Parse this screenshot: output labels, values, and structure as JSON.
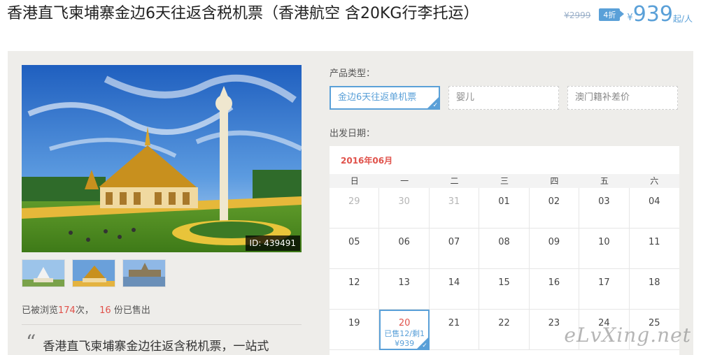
{
  "product": {
    "title": "香港直飞柬埔寨金边6天往返含税机票（香港航空 含20KG行李托运）"
  },
  "price": {
    "original": "¥2999",
    "discount": "4折",
    "currency": "¥",
    "amount": "939",
    "unit": "起/人"
  },
  "gallery": {
    "photo_id": "ID: 439491"
  },
  "stats": {
    "prefix": "已被浏览",
    "views": "174",
    "middle": "次，",
    "sold": "16",
    "suffix": "份已售出"
  },
  "description": {
    "quote_mark": "“",
    "text": "香港直飞柬埔寨金边往返含税机票，一站式"
  },
  "product_type": {
    "label": "产品类型：",
    "options": [
      {
        "label": "金边6天往返单机票",
        "selected": true
      },
      {
        "label": "婴儿",
        "selected": false
      },
      {
        "label": "澳门籍补差价",
        "selected": false
      }
    ]
  },
  "departure": {
    "label": "出发日期：",
    "month": "2016年06月",
    "weekdays": [
      "日",
      "一",
      "二",
      "三",
      "四",
      "五",
      "六"
    ],
    "days": [
      {
        "day": "29",
        "muted": true
      },
      {
        "day": "30",
        "muted": true
      },
      {
        "day": "31",
        "muted": true
      },
      {
        "day": "01"
      },
      {
        "day": "02"
      },
      {
        "day": "03"
      },
      {
        "day": "04"
      },
      {
        "day": "05"
      },
      {
        "day": "06"
      },
      {
        "day": "07"
      },
      {
        "day": "08"
      },
      {
        "day": "09"
      },
      {
        "day": "10"
      },
      {
        "day": "11"
      },
      {
        "day": "12"
      },
      {
        "day": "13"
      },
      {
        "day": "14"
      },
      {
        "day": "15"
      },
      {
        "day": "16"
      },
      {
        "day": "17"
      },
      {
        "day": "18"
      },
      {
        "day": "19"
      },
      {
        "day": "20",
        "selected": true,
        "sold": "已售12/剩1",
        "price": "¥939"
      },
      {
        "day": "21"
      },
      {
        "day": "22"
      },
      {
        "day": "23"
      },
      {
        "day": "24"
      },
      {
        "day": "25"
      }
    ]
  },
  "watermark": "eLvXing.net",
  "colors": {
    "accent": "#5aa0d8",
    "highlight": "#e0524b",
    "panel_bg": "#eeedea"
  }
}
